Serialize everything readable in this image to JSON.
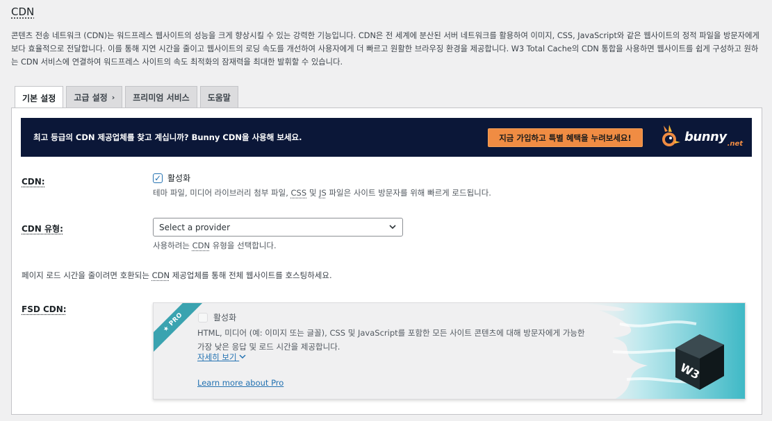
{
  "page": {
    "title": "CDN",
    "intro": "콘텐츠 전송 네트워크 (CDN)는 워드프레스 웹사이트의 성능을 크게 향상시킬 수 있는 강력한 기능입니다. CDN은 전 세계에 분산된 서버 네트워크를 활용하여 이미지, CSS, JavaScript와 같은 웹사이트의 정적 파일을 방문자에게 보다 효율적으로 전달합니다. 이를 통해 지연 시간을 줄이고 웹사이트의 로딩 속도를 개선하여 사용자에게 더 빠르고 원활한 브라우징 환경을 제공합니다. W3 Total Cache의 CDN 통합을 사용하면 웹사이트를 쉽게 구성하고 원하는 CDN 서비스에 연결하여 워드프레스 사이트의 속도 최적화의 잠재력을 최대한 발휘할 수 있습니다."
  },
  "tabs": [
    {
      "label": "기본 설정",
      "active": true
    },
    {
      "label": "고급 설정",
      "chevron": "›"
    },
    {
      "label": "프리미엄 서비스"
    },
    {
      "label": "도움말"
    }
  ],
  "banner": {
    "text": "최고 등급의 CDN 제공업체를 찾고 계십니까? Bunny CDN을 사용해 보세요.",
    "cta": "지금 가입하고 특별 혜택을 누려보세요!",
    "logo_word": "bunny",
    "logo_suffix": ".net",
    "bg_color": "#0b1738",
    "cta_color": "#f08c43"
  },
  "cdn": {
    "label": "CDN:",
    "checkbox_label": "활성화",
    "checked": true,
    "desc_pre": "테마 파일, 미디어 라이브러리 첨부 파일, ",
    "desc_css": "CSS",
    "desc_mid": " 및 ",
    "desc_js": "JS",
    "desc_post": " 파일은 사이트 방문자를 위해 빠르게 로드됩니다."
  },
  "cdn_type": {
    "label": "CDN 유형:",
    "selected": "Select a provider",
    "desc_pre": "사용하려는 ",
    "desc_cdn": "CDN",
    "desc_post": " 유형을 선택합니다."
  },
  "hosting_note": {
    "pre": "페이지 로드 시간을 줄이려면 호환되는 ",
    "cdn": "CDN",
    "post": " 제공업체를 통해 전체 웹사이트를 호스팅하세요."
  },
  "fsd": {
    "label": "FSD CDN:",
    "ribbon": "★ PRO",
    "checkbox_label": "활성화",
    "checked": false,
    "desc": "HTML, 미디어 (예: 이미지 또는 글꼴), CSS 및 JavaScript를 포함한 모든 사이트 콘텐츠에 대해 방문자에게 가능한 가장 낮은 응답 및 로드 시간을 제공합니다.",
    "more_link": "자세히 보기",
    "learn_link": "Learn more about Pro",
    "art_text": "W3"
  }
}
